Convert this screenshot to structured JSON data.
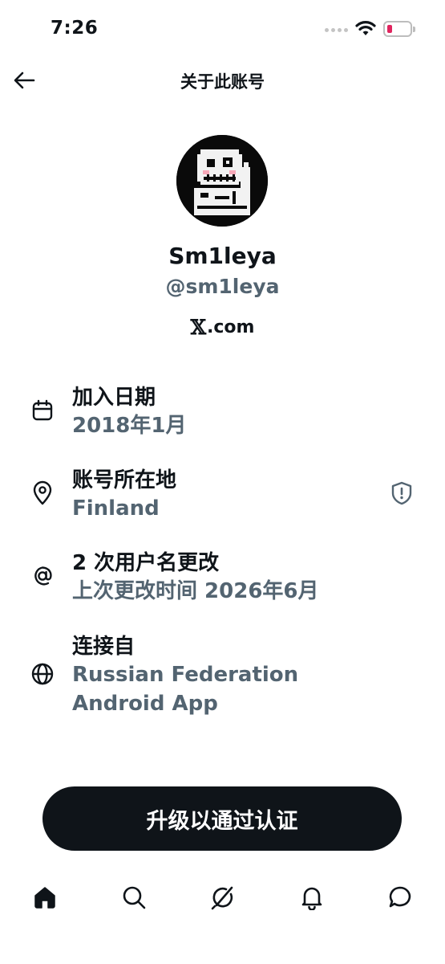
{
  "status_bar": {
    "time": "7:26"
  },
  "header": {
    "title": "关于此账号"
  },
  "profile": {
    "display_name": "Sm1leya",
    "handle": "@sm1leya",
    "site_logo": "𝕏",
    "site_domain": ".com"
  },
  "info": {
    "joined": {
      "label": "加入日期",
      "value": "2018年1月",
      "icon": "calendar-icon"
    },
    "location": {
      "label": "账号所在地",
      "value": "Finland",
      "icon": "location-pin-icon",
      "badge_icon": "shield-alert-icon"
    },
    "username_changes": {
      "label": "2 次用户名更改",
      "value": "上次更改时间 2026年6月",
      "icon": "at-sign-icon"
    },
    "connected": {
      "label": "连接自",
      "value_line1": "Russian Federation",
      "value_line2": "Android App",
      "icon": "globe-icon"
    }
  },
  "cta": {
    "label": "升级以通过认证"
  },
  "tabs": [
    {
      "name": "home",
      "icon": "home-icon",
      "active": true
    },
    {
      "name": "search",
      "icon": "search-icon"
    },
    {
      "name": "grok",
      "icon": "grok-icon"
    },
    {
      "name": "notifications",
      "icon": "bell-icon"
    },
    {
      "name": "messages",
      "icon": "message-icon"
    }
  ],
  "colors": {
    "primary_text": "#0f1419",
    "secondary_text": "#536471",
    "cta_bg": "#0f1419",
    "battery_low": "#e0245e"
  }
}
